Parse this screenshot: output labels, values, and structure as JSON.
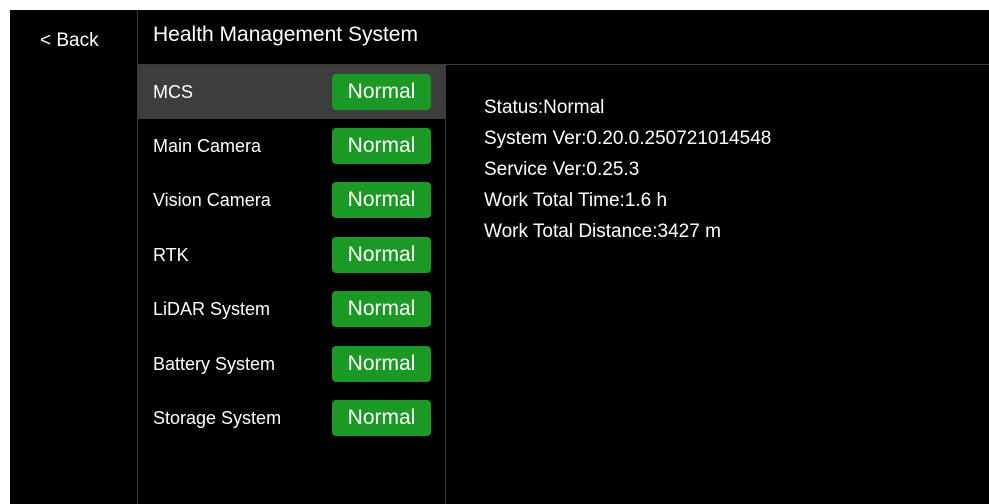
{
  "navigation": {
    "back_label": "< Back"
  },
  "header": {
    "title": "Health Management System"
  },
  "modules": [
    {
      "name": "MCS",
      "status": "Normal",
      "selected": true
    },
    {
      "name": "Main Camera",
      "status": "Normal",
      "selected": false
    },
    {
      "name": "Vision Camera",
      "status": "Normal",
      "selected": false
    },
    {
      "name": "RTK",
      "status": "Normal",
      "selected": false
    },
    {
      "name": "LiDAR System",
      "status": "Normal",
      "selected": false
    },
    {
      "name": "Battery System",
      "status": "Normal",
      "selected": false
    },
    {
      "name": "Storage System",
      "status": "Normal",
      "selected": false
    }
  ],
  "details": {
    "status": "Status:Normal",
    "system_version": "System Ver:0.20.0.250721014548",
    "service_version": "Service Ver:0.25.3",
    "work_total_time": "Work Total Time:1.6 h",
    "work_total_distance": "Work Total Distance:3427 m"
  },
  "colors": {
    "background": "#000000",
    "selected_row": "#3d3d3d",
    "status_normal": "#1a9a24",
    "divider": "#3a3a3a",
    "text": "#ffffff"
  }
}
